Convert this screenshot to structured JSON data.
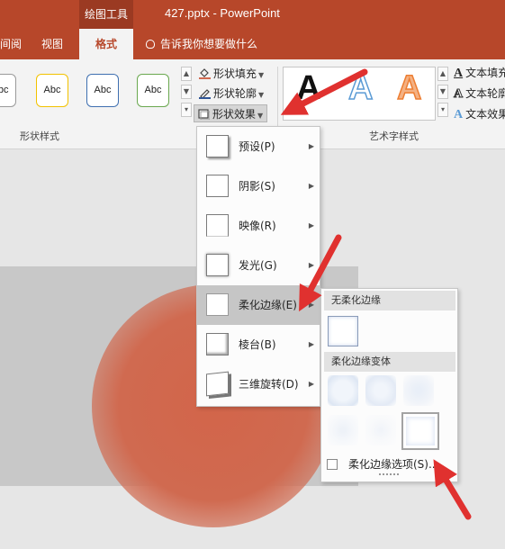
{
  "window": {
    "context_group": "绘图工具",
    "title": "427.pptx - PowerPoint"
  },
  "tabs": [
    {
      "label": "间阅"
    },
    {
      "label": "视图"
    },
    {
      "label": "格式",
      "active": true
    }
  ],
  "tell_me": "告诉我你想要做什么",
  "shape_styles": {
    "swatch_label": "Abc",
    "swatch_colors": [
      "#9a9a9a",
      "#f2c200",
      "#3e6fb0",
      "#6aa84f"
    ],
    "commands": {
      "fill": "形状填充",
      "outline": "形状轮廓",
      "effects": "形状效果"
    },
    "group_label": "形状样式"
  },
  "wordart_styles": {
    "letters": [
      "A",
      "A",
      "A"
    ],
    "letter_colors": [
      "#111111",
      "#5b9bd5",
      "#ed7d31"
    ],
    "commands": {
      "fill": "文本填充",
      "outline": "文本轮廓",
      "effects": "文本效果"
    },
    "group_label": "艺术字样式"
  },
  "effects_menu": {
    "items": [
      {
        "label": "预设(P)"
      },
      {
        "label": "阴影(S)"
      },
      {
        "label": "映像(R)"
      },
      {
        "label": "发光(G)"
      },
      {
        "label": "柔化边缘(E)",
        "highlighted": true
      },
      {
        "label": "棱台(B)"
      },
      {
        "label": "三维旋转(D)"
      }
    ]
  },
  "soft_edges_submenu": {
    "no_soft_edges_header": "无柔化边缘",
    "variations_header": "柔化边缘变体",
    "options_label": "柔化边缘选项(S)..."
  },
  "colors": {
    "accent": "#b7472a",
    "shape_fill": "#d06a50",
    "arrow": "#e0312f"
  }
}
